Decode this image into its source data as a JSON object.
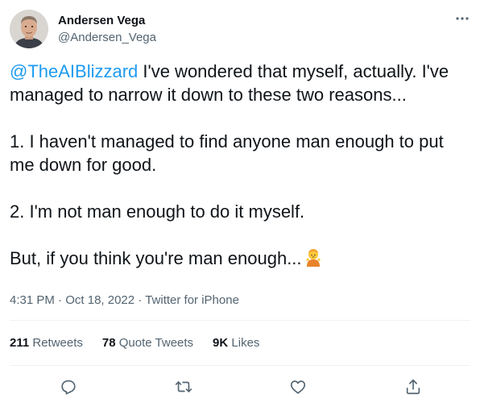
{
  "user": {
    "name": "Andersen Vega",
    "handle": "@Andersen_Vega"
  },
  "tweet": {
    "mention": "@TheAIBlizzard",
    "line1_rest": " I've wondered that myself, actually. I've",
    "line2": "managed to narrow it down to these two reasons...",
    "reason1_line1": "1. I haven't managed to find anyone man enough to put",
    "reason1_line2": "me down for good.",
    "reason2": "2. I'm not man enough to do it myself.",
    "closing": "But, if you think you're man enough...",
    "emoji": "person-shrugging-emoji"
  },
  "meta": {
    "time": "4:31 PM",
    "sep1": " · ",
    "date": "Oct 18, 2022",
    "sep2": " · ",
    "source": "Twitter for iPhone"
  },
  "stats": {
    "retweets_count": "211",
    "retweets_label": "Retweets",
    "quotes_count": "78",
    "quotes_label": "Quote Tweets",
    "likes_count": "9K",
    "likes_label": "Likes"
  },
  "icons": {
    "more": "more-horizontal-icon",
    "reply": "reply-icon",
    "retweet": "retweet-icon",
    "like": "heart-icon",
    "share": "share-icon"
  },
  "colors": {
    "link": "#1d9bf0",
    "secondary_text": "#536471",
    "primary_text": "#0f1419",
    "divider": "#eff3f4"
  }
}
